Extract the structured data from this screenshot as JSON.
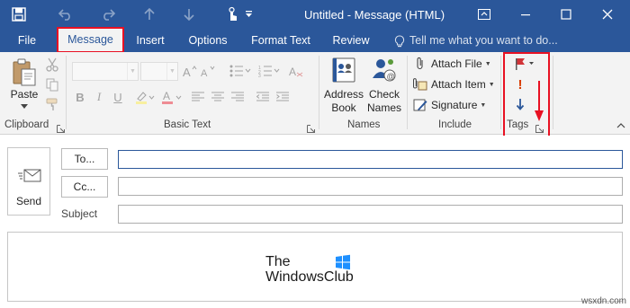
{
  "titlebar": {
    "title": "Untitled  -  Message (HTML)",
    "bg_color": "#2b579a"
  },
  "tabs": [
    {
      "label": "File"
    },
    {
      "label": "Message"
    },
    {
      "label": "Insert"
    },
    {
      "label": "Options"
    },
    {
      "label": "Format Text"
    },
    {
      "label": "Review"
    }
  ],
  "active_tab": "Message",
  "tell_me": {
    "placeholder": "Tell me what you want to do..."
  },
  "ribbon": {
    "clipboard": {
      "label": "Clipboard",
      "paste_label": "Paste"
    },
    "basic_text": {
      "label": "Basic Text"
    },
    "names": {
      "label": "Names",
      "address_book": [
        "Address",
        "Book"
      ],
      "check_names": [
        "Check",
        "Names"
      ]
    },
    "include": {
      "label": "Include",
      "attach_file": "Attach File",
      "attach_item": "Attach Item",
      "signature": "Signature"
    },
    "tags": {
      "label": "Tags"
    }
  },
  "compose": {
    "send_label": "Send",
    "to_label": "To...",
    "cc_label": "Cc...",
    "subject_label": "Subject",
    "to_value": "",
    "cc_value": "",
    "subject_value": ""
  },
  "watermark": {
    "line1": "The",
    "line2": "WindowsClub"
  },
  "credit": "wsxdn.com",
  "colors": {
    "accent": "#2b579a",
    "highlight": "#e81123",
    "flag": "#d13438",
    "importance_high": "#d83b01",
    "importance_low": "#2b579a"
  }
}
